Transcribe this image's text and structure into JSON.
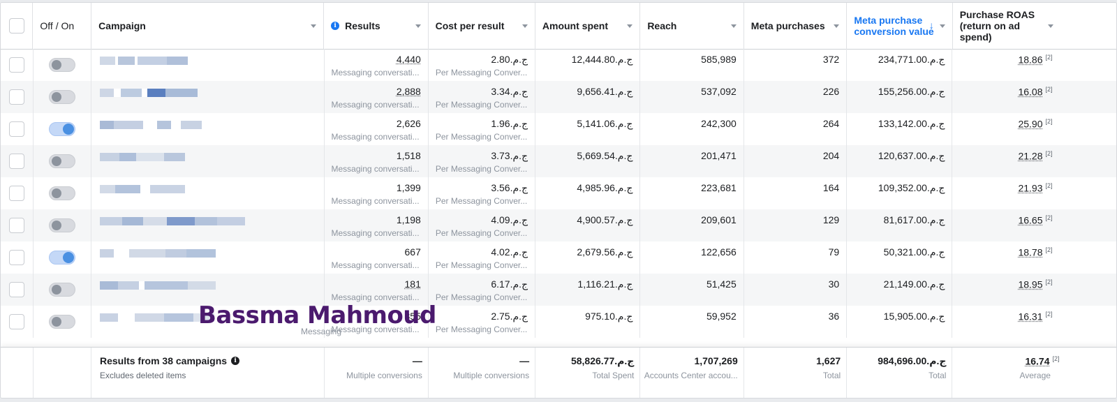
{
  "header": {
    "off_on": "Off / On",
    "campaign": "Campaign",
    "results": "Results",
    "cost_per_result": "Cost per result",
    "amount_spent": "Amount spent",
    "reach": "Reach",
    "meta_purchases": "Meta purchases",
    "meta_purchase_value": "Meta purchase conversion value",
    "purchase_roas": "Purchase ROAS (return on ad spend)",
    "sort_arrow": "↓"
  },
  "rows": [
    {
      "on": false,
      "results": "4,440",
      "results_sub": "Messaging conversati...",
      "cpr": "2.80.ج.م",
      "cpr_sub": "Per Messaging Conver...",
      "spent": "12,444.80.ج.م",
      "reach": "585,989",
      "purchases": "372",
      "value": "234,771.00.ج.م",
      "roas": "18.86",
      "roas_note": "[2]",
      "results_ul": true
    },
    {
      "on": false,
      "results": "2,888",
      "results_sub": "Messaging conversati...",
      "cpr": "3.34.ج.م",
      "cpr_sub": "Per Messaging Conver...",
      "spent": "9,656.41.ج.م",
      "reach": "537,092",
      "purchases": "226",
      "value": "155,256.00.ج.م",
      "roas": "16.08",
      "roas_note": "[2]",
      "results_ul": true
    },
    {
      "on": true,
      "results": "2,626",
      "results_sub": "Messaging conversati...",
      "cpr": "1.96.ج.م",
      "cpr_sub": "Per Messaging Conver...",
      "spent": "5,141.06.ج.م",
      "reach": "242,300",
      "purchases": "264",
      "value": "133,142.00.ج.م",
      "roas": "25.90",
      "roas_note": "[2]",
      "results_ul": false
    },
    {
      "on": false,
      "results": "1,518",
      "results_sub": "Messaging conversati...",
      "cpr": "3.73.ج.م",
      "cpr_sub": "Per Messaging Conver...",
      "spent": "5,669.54.ج.م",
      "reach": "201,471",
      "purchases": "204",
      "value": "120,637.00.ج.م",
      "roas": "21.28",
      "roas_note": "[2]",
      "results_ul": false
    },
    {
      "on": false,
      "results": "1,399",
      "results_sub": "Messaging conversati...",
      "cpr": "3.56.ج.م",
      "cpr_sub": "Per Messaging Conver...",
      "spent": "4,985.96.ج.م",
      "reach": "223,681",
      "purchases": "164",
      "value": "109,352.00.ج.م",
      "roas": "21.93",
      "roas_note": "[2]",
      "results_ul": false
    },
    {
      "on": false,
      "results": "1,198",
      "results_sub": "Messaging conversati...",
      "cpr": "4.09.ج.م",
      "cpr_sub": "Per Messaging Conver...",
      "spent": "4,900.57.ج.م",
      "reach": "209,601",
      "purchases": "129",
      "value": "81,617.00.ج.م",
      "roas": "16.65",
      "roas_note": "[2]",
      "results_ul": false
    },
    {
      "on": true,
      "results": "667",
      "results_sub": "Messaging conversati...",
      "cpr": "4.02.ج.م",
      "cpr_sub": "Per Messaging Conver...",
      "spent": "2,679.56.ج.م",
      "reach": "122,656",
      "purchases": "79",
      "value": "50,321.00.ج.م",
      "roas": "18.78",
      "roas_note": "[2]",
      "results_ul": false
    },
    {
      "on": false,
      "results": "181",
      "results_sub": "Messaging conversati...",
      "cpr": "6.17.ج.م",
      "cpr_sub": "Per Messaging Conver...",
      "spent": "1,116.21.ج.م",
      "reach": "51,425",
      "purchases": "30",
      "value": "21,149.00.ج.م",
      "roas": "18.95",
      "roas_note": "[2]",
      "results_ul": true
    },
    {
      "on": false,
      "results": "355",
      "results_sub": "Messaging conversati...",
      "cpr": "2.75.ج.م",
      "cpr_sub": "Per Messaging Conver...",
      "spent": "975.10.ج.م",
      "reach": "59,952",
      "purchases": "36",
      "value": "15,905.00.ج.م",
      "roas": "16.31",
      "roas_note": "[2]",
      "results_ul": false
    }
  ],
  "footer": {
    "title": "Results from 38 campaigns",
    "note": "Excludes deleted items",
    "results": "—",
    "results_sub": "Multiple conversions",
    "cpr": "—",
    "cpr_sub": "Multiple conversions",
    "spent": "58,826.77.ج.م",
    "spent_sub": "Total Spent",
    "reach": "1,707,269",
    "reach_sub": "Accounts Center accou...",
    "purchases": "1,627",
    "purchases_sub": "Total",
    "value": "984,696.00.ج.م",
    "value_sub": "Total",
    "roas": "16.74",
    "roas_note": "[2]",
    "roas_sub": "Average"
  },
  "watermark": "Bassma Mahmoud",
  "watermark_sub": "Messaging",
  "colors": {
    "accent": "#1877f2",
    "watermark": "#4b1a6e",
    "toggle_on": "#4a90e2"
  }
}
